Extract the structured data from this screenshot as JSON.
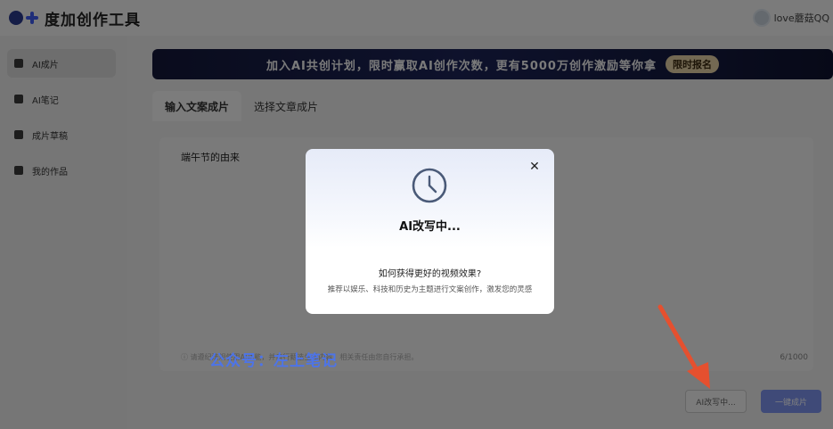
{
  "app": {
    "logo_text": "度加创作工具",
    "user_name": "love蘑菇QQ"
  },
  "sidebar": {
    "items": [
      {
        "label": "AI成片",
        "icon": "plus-square-icon"
      },
      {
        "label": "AI笔记",
        "icon": "note-icon"
      },
      {
        "label": "成片草稿",
        "icon": "video-draft-icon"
      },
      {
        "label": "我的作品",
        "icon": "check-square-icon"
      }
    ],
    "active_index": 0
  },
  "banner": {
    "text": "加入AI共创计划，限时赢取AI创作次数，更有5000万创作激励等你拿",
    "badge": "限时报名"
  },
  "tabs": [
    {
      "label": "输入文案成片",
      "active": true
    },
    {
      "label": "选择文章成片",
      "active": false
    }
  ],
  "editor": {
    "content": "端午节的由来",
    "disclaimer": "ⓘ 请遵纪法规使用AI功能，并自行甄选生成内容，相关责任由您自行承担。",
    "char_count": "6/1000"
  },
  "watermark": "公众号：左上笔记",
  "actions": {
    "rewriting_label": "AI改写中...",
    "generate_label": "一键成片"
  },
  "modal": {
    "title": "AI改写中...",
    "question": "如何获得更好的视频效果?",
    "tip": "推荐以娱乐、科技和历史为主题进行文案创作，激发您的灵感",
    "icons": {
      "status": "clock-icon",
      "close": "close-icon"
    }
  },
  "colors": {
    "accent": "#3f5cf2",
    "banner_bg": "#14183a",
    "banner_badge": "#e7d3a7",
    "annotation_arrow": "#e5502f",
    "watermark": "#4d74e8"
  }
}
